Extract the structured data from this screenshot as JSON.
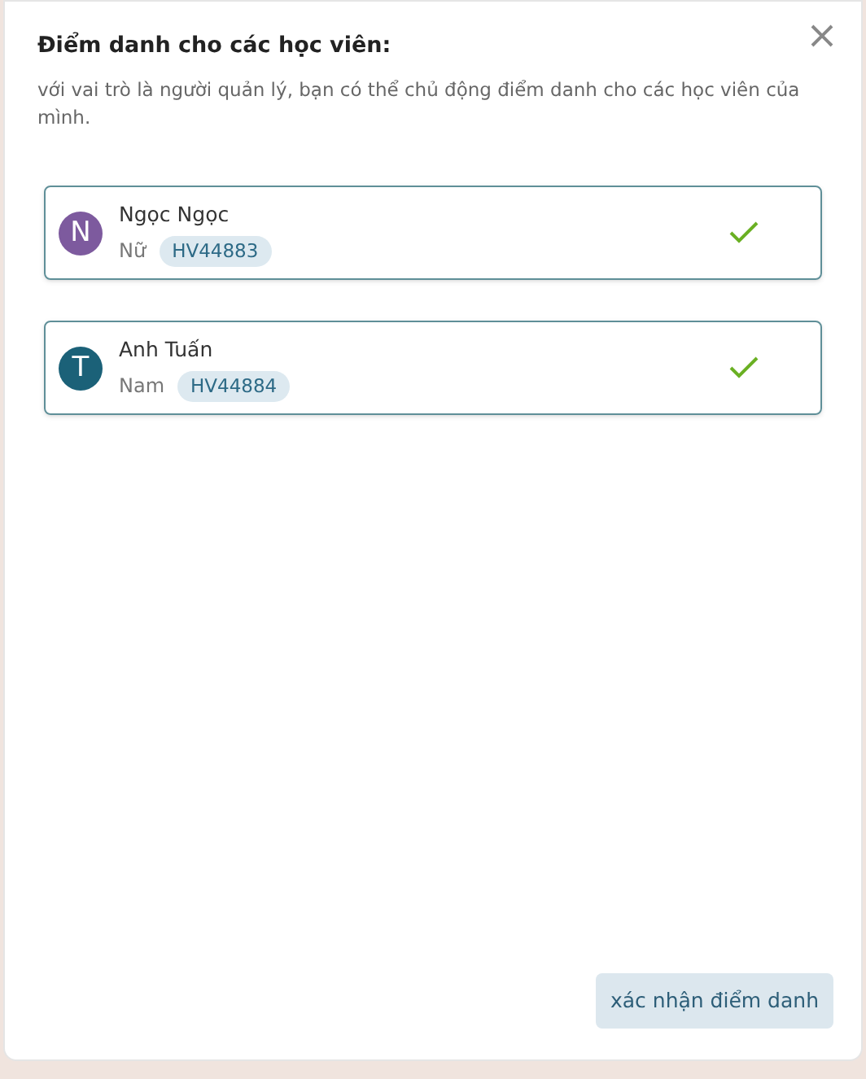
{
  "dialog": {
    "title": "Điểm danh cho các học viên:",
    "description": "với vai trò là người quản lý, bạn có thể chủ động điểm danh cho các học viên của mình."
  },
  "students": [
    {
      "initial": "N",
      "color": "#7d5a9e",
      "name": "Ngọc Ngọc",
      "gender": "Nữ",
      "code": "HV44883",
      "checked": true
    },
    {
      "initial": "T",
      "color": "#1b6178",
      "name": "Anh Tuấn",
      "gender": "Nam",
      "code": "HV44884",
      "checked": true
    }
  ],
  "confirm_button": "xác nhận điểm danh"
}
